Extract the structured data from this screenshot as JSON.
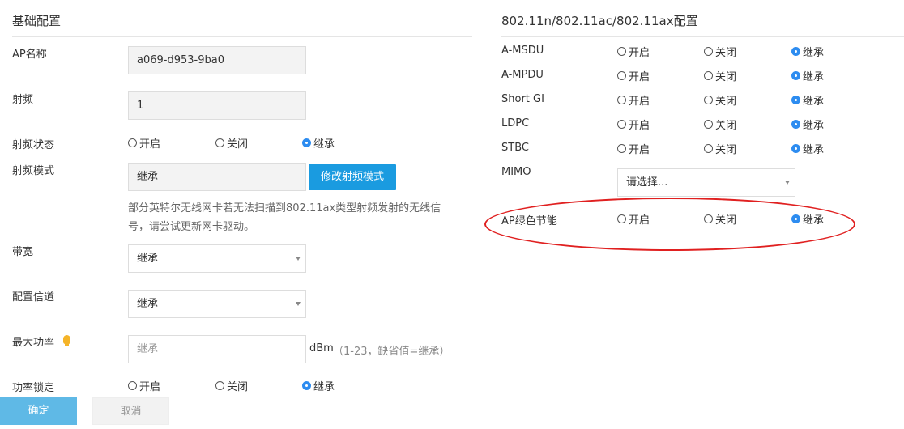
{
  "left": {
    "title": "基础配置",
    "ap_name": {
      "label": "AP名称",
      "value": "a069-d953-9ba0"
    },
    "radio_freq": {
      "label": "射频",
      "value": "1"
    },
    "radio_state": {
      "label": "射频状态",
      "options": [
        "开启",
        "关闭",
        "继承"
      ],
      "selected": "继承"
    },
    "radio_mode": {
      "label": "射频模式",
      "value": "继承",
      "button": "修改射频模式",
      "note_line1": "部分英特尔无线网卡若无法扫描到802.11ax类型射频发射的无线信",
      "note_line2": "号，请尝试更新网卡驱动。"
    },
    "bandwidth": {
      "label": "带宽",
      "value": "继承"
    },
    "channel": {
      "label": "配置信道",
      "value": "继承"
    },
    "max_power": {
      "label": "最大功率",
      "placeholder": "继承",
      "unit": "dBm",
      "hint": "（1-23，缺省值=继承）"
    },
    "power_lock": {
      "label": "功率锁定",
      "options": [
        "开启",
        "关闭",
        "继承"
      ],
      "selected": "继承"
    }
  },
  "right": {
    "title": "802.11n/802.11ac/802.11ax配置",
    "rows": [
      {
        "label": "A-MSDU",
        "options": [
          "开启",
          "关闭",
          "继承"
        ],
        "selected": "继承"
      },
      {
        "label": "A-MPDU",
        "options": [
          "开启",
          "关闭",
          "继承"
        ],
        "selected": "继承"
      },
      {
        "label": "Short GI",
        "options": [
          "开启",
          "关闭",
          "继承"
        ],
        "selected": "继承"
      },
      {
        "label": "LDPC",
        "options": [
          "开启",
          "关闭",
          "继承"
        ],
        "selected": "继承"
      },
      {
        "label": "STBC",
        "options": [
          "开启",
          "关闭",
          "继承"
        ],
        "selected": "继承"
      }
    ],
    "mimo": {
      "label": "MIMO",
      "value": "请选择..."
    },
    "green": {
      "label": "AP绿色节能",
      "options": [
        "开启",
        "关闭",
        "继承"
      ],
      "selected": "继承"
    }
  },
  "footer": {
    "confirm": "确定",
    "cancel": "取消"
  },
  "colors": {
    "accent": "#1a9be0",
    "highlight": "#e02020"
  }
}
